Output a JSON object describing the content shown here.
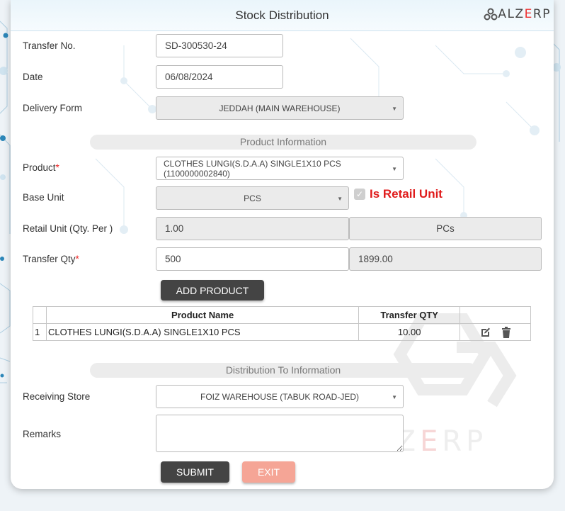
{
  "header": {
    "title": "Stock Distribution",
    "logo": {
      "text_before": "ALZ",
      "text_accent": "E",
      "text_after": "RP"
    }
  },
  "form": {
    "transfer_no": {
      "label": "Transfer No.",
      "value": "SD-300530-24"
    },
    "date": {
      "label": "Date",
      "value": "06/08/2024"
    },
    "delivery_form": {
      "label": "Delivery Form",
      "value": "JEDDAH (MAIN WAREHOUSE)"
    }
  },
  "product_section": {
    "title": "Product Information",
    "product": {
      "label": "Product",
      "required_mark": "*",
      "value": "CLOTHES LUNGI(S.D.A.A) SINGLE1X10 PCS (1100000002840)"
    },
    "base_unit": {
      "label": "Base Unit",
      "value": "PCS"
    },
    "is_retail": {
      "label": "Is Retail Unit",
      "checked": true
    },
    "retail_unit": {
      "label": "Retail Unit (Qty. Per )",
      "value": "1.00",
      "unit": "PCs"
    },
    "transfer_qty": {
      "label": "Transfer Qty",
      "required_mark": "*",
      "value": "500",
      "available": "1899.00"
    },
    "add_button": "ADD PRODUCT"
  },
  "table": {
    "headers": {
      "no": "",
      "name": "Product Name",
      "qty": "Transfer QTY",
      "actions": ""
    },
    "rows": [
      {
        "no": "1",
        "name": "CLOTHES LUNGI(S.D.A.A) SINGLE1X10 PCS",
        "qty": "10.00"
      }
    ]
  },
  "distribution_section": {
    "title": "Distribution To Information",
    "receiving_store": {
      "label": "Receiving Store",
      "value": "FOIZ WAREHOUSE (TABUK ROAD-JED)"
    },
    "remarks": {
      "label": "Remarks",
      "value": ""
    }
  },
  "footer": {
    "submit": "SUBMIT",
    "exit": "EXIT"
  },
  "colors": {
    "accent_red": "#e01b1b",
    "dark_button": "#444444",
    "exit_button": "#f5a596"
  }
}
